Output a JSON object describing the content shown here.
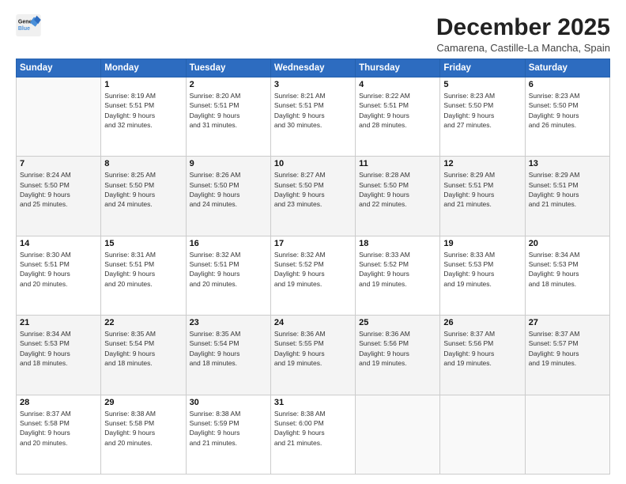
{
  "logo": {
    "line1": "General",
    "line2": "Blue"
  },
  "title": "December 2025",
  "location": "Camarena, Castille-La Mancha, Spain",
  "weekdays": [
    "Sunday",
    "Monday",
    "Tuesday",
    "Wednesday",
    "Thursday",
    "Friday",
    "Saturday"
  ],
  "weeks": [
    [
      {
        "day": "",
        "info": ""
      },
      {
        "day": "1",
        "info": "Sunrise: 8:19 AM\nSunset: 5:51 PM\nDaylight: 9 hours\nand 32 minutes."
      },
      {
        "day": "2",
        "info": "Sunrise: 8:20 AM\nSunset: 5:51 PM\nDaylight: 9 hours\nand 31 minutes."
      },
      {
        "day": "3",
        "info": "Sunrise: 8:21 AM\nSunset: 5:51 PM\nDaylight: 9 hours\nand 30 minutes."
      },
      {
        "day": "4",
        "info": "Sunrise: 8:22 AM\nSunset: 5:51 PM\nDaylight: 9 hours\nand 28 minutes."
      },
      {
        "day": "5",
        "info": "Sunrise: 8:23 AM\nSunset: 5:50 PM\nDaylight: 9 hours\nand 27 minutes."
      },
      {
        "day": "6",
        "info": "Sunrise: 8:23 AM\nSunset: 5:50 PM\nDaylight: 9 hours\nand 26 minutes."
      }
    ],
    [
      {
        "day": "7",
        "info": "Sunrise: 8:24 AM\nSunset: 5:50 PM\nDaylight: 9 hours\nand 25 minutes."
      },
      {
        "day": "8",
        "info": "Sunrise: 8:25 AM\nSunset: 5:50 PM\nDaylight: 9 hours\nand 24 minutes."
      },
      {
        "day": "9",
        "info": "Sunrise: 8:26 AM\nSunset: 5:50 PM\nDaylight: 9 hours\nand 24 minutes."
      },
      {
        "day": "10",
        "info": "Sunrise: 8:27 AM\nSunset: 5:50 PM\nDaylight: 9 hours\nand 23 minutes."
      },
      {
        "day": "11",
        "info": "Sunrise: 8:28 AM\nSunset: 5:50 PM\nDaylight: 9 hours\nand 22 minutes."
      },
      {
        "day": "12",
        "info": "Sunrise: 8:29 AM\nSunset: 5:51 PM\nDaylight: 9 hours\nand 21 minutes."
      },
      {
        "day": "13",
        "info": "Sunrise: 8:29 AM\nSunset: 5:51 PM\nDaylight: 9 hours\nand 21 minutes."
      }
    ],
    [
      {
        "day": "14",
        "info": "Sunrise: 8:30 AM\nSunset: 5:51 PM\nDaylight: 9 hours\nand 20 minutes."
      },
      {
        "day": "15",
        "info": "Sunrise: 8:31 AM\nSunset: 5:51 PM\nDaylight: 9 hours\nand 20 minutes."
      },
      {
        "day": "16",
        "info": "Sunrise: 8:32 AM\nSunset: 5:51 PM\nDaylight: 9 hours\nand 20 minutes."
      },
      {
        "day": "17",
        "info": "Sunrise: 8:32 AM\nSunset: 5:52 PM\nDaylight: 9 hours\nand 19 minutes."
      },
      {
        "day": "18",
        "info": "Sunrise: 8:33 AM\nSunset: 5:52 PM\nDaylight: 9 hours\nand 19 minutes."
      },
      {
        "day": "19",
        "info": "Sunrise: 8:33 AM\nSunset: 5:53 PM\nDaylight: 9 hours\nand 19 minutes."
      },
      {
        "day": "20",
        "info": "Sunrise: 8:34 AM\nSunset: 5:53 PM\nDaylight: 9 hours\nand 18 minutes."
      }
    ],
    [
      {
        "day": "21",
        "info": "Sunrise: 8:34 AM\nSunset: 5:53 PM\nDaylight: 9 hours\nand 18 minutes."
      },
      {
        "day": "22",
        "info": "Sunrise: 8:35 AM\nSunset: 5:54 PM\nDaylight: 9 hours\nand 18 minutes."
      },
      {
        "day": "23",
        "info": "Sunrise: 8:35 AM\nSunset: 5:54 PM\nDaylight: 9 hours\nand 18 minutes."
      },
      {
        "day": "24",
        "info": "Sunrise: 8:36 AM\nSunset: 5:55 PM\nDaylight: 9 hours\nand 19 minutes."
      },
      {
        "day": "25",
        "info": "Sunrise: 8:36 AM\nSunset: 5:56 PM\nDaylight: 9 hours\nand 19 minutes."
      },
      {
        "day": "26",
        "info": "Sunrise: 8:37 AM\nSunset: 5:56 PM\nDaylight: 9 hours\nand 19 minutes."
      },
      {
        "day": "27",
        "info": "Sunrise: 8:37 AM\nSunset: 5:57 PM\nDaylight: 9 hours\nand 19 minutes."
      }
    ],
    [
      {
        "day": "28",
        "info": "Sunrise: 8:37 AM\nSunset: 5:58 PM\nDaylight: 9 hours\nand 20 minutes."
      },
      {
        "day": "29",
        "info": "Sunrise: 8:38 AM\nSunset: 5:58 PM\nDaylight: 9 hours\nand 20 minutes."
      },
      {
        "day": "30",
        "info": "Sunrise: 8:38 AM\nSunset: 5:59 PM\nDaylight: 9 hours\nand 21 minutes."
      },
      {
        "day": "31",
        "info": "Sunrise: 8:38 AM\nSunset: 6:00 PM\nDaylight: 9 hours\nand 21 minutes."
      },
      {
        "day": "",
        "info": ""
      },
      {
        "day": "",
        "info": ""
      },
      {
        "day": "",
        "info": ""
      }
    ]
  ]
}
